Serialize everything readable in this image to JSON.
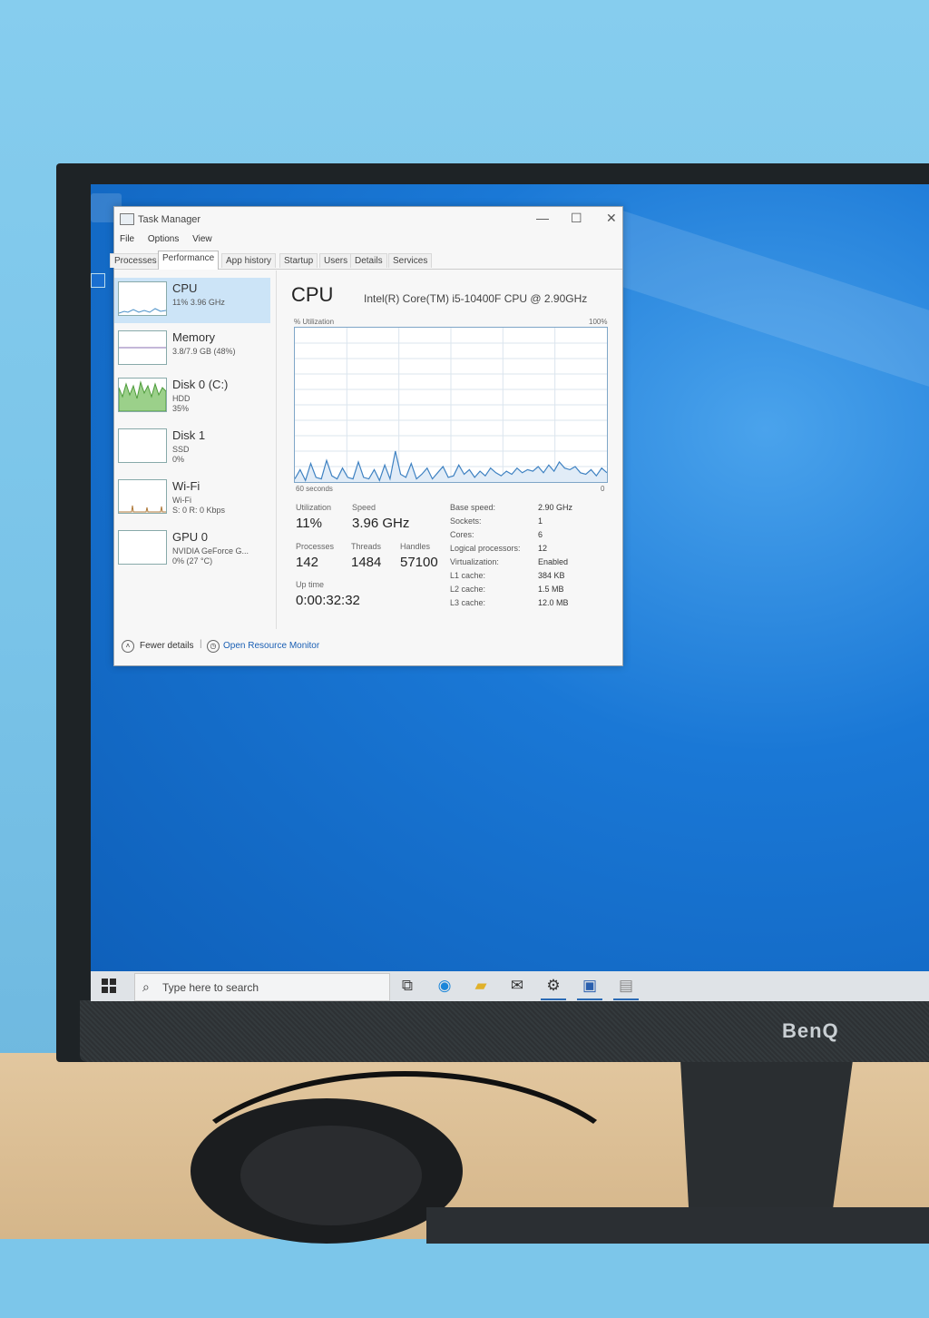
{
  "window": {
    "title": "Task Manager",
    "controls": {
      "minimize": "—",
      "maximize": "☐",
      "close": "✕"
    }
  },
  "menu": [
    "File",
    "Options",
    "View"
  ],
  "tabs": [
    "Processes",
    "Performance",
    "App history",
    "Startup",
    "Users",
    "Details",
    "Services"
  ],
  "active_tab": "Performance",
  "sidebar": {
    "items": [
      {
        "name": "CPU",
        "sub1": "11% 3.96 GHz",
        "sub2": "",
        "sub3": ""
      },
      {
        "name": "Memory",
        "sub1": "3.8/7.9 GB (48%)",
        "sub2": "",
        "sub3": ""
      },
      {
        "name": "Disk 0 (C:)",
        "sub1": "HDD",
        "sub2": "35%",
        "sub3": ""
      },
      {
        "name": "Disk 1",
        "sub1": "SSD",
        "sub2": "0%",
        "sub3": ""
      },
      {
        "name": "Wi-Fi",
        "sub1": "Wi-Fi",
        "sub2": "S: 0 R: 0 Kbps",
        "sub3": ""
      },
      {
        "name": "GPU 0",
        "sub1": "NVIDIA GeForce G...",
        "sub2": "0% (27 °C)",
        "sub3": ""
      }
    ]
  },
  "main": {
    "title": "CPU",
    "cpu_name": "Intel(R) Core(TM) i5-10400F CPU @ 2.90GHz",
    "graph_label_left": "% Utilization",
    "graph_label_right": "100%",
    "graph_bottom_left": "60 seconds",
    "graph_bottom_right": "0",
    "utilization_label": "Utilization",
    "utilization": "11%",
    "speed_label": "Speed",
    "speed": "3.96 GHz",
    "processes_label": "Processes",
    "processes": "142",
    "threads_label": "Threads",
    "threads": "1484",
    "handles_label": "Handles",
    "handles": "57100",
    "uptime_label": "Up time",
    "uptime": "0:00:32:32",
    "specs": [
      {
        "k": "Base speed:",
        "v": "2.90 GHz"
      },
      {
        "k": "Sockets:",
        "v": "1"
      },
      {
        "k": "Cores:",
        "v": "6"
      },
      {
        "k": "Logical processors:",
        "v": "12"
      },
      {
        "k": "Virtualization:",
        "v": "Enabled"
      },
      {
        "k": "L1 cache:",
        "v": "384 KB"
      },
      {
        "k": "L2 cache:",
        "v": "1.5 MB"
      },
      {
        "k": "L3 cache:",
        "v": "12.0 MB"
      }
    ]
  },
  "footer": {
    "fewer_details": "Fewer details",
    "resource_monitor": "Open Resource Monitor"
  },
  "taskbar": {
    "search_placeholder": "Type here to search"
  },
  "monitor_brand": "BenQ",
  "cpu_history": [
    2,
    8,
    1,
    12,
    3,
    2,
    14,
    4,
    2,
    9,
    3,
    2,
    13,
    3,
    2,
    8,
    1,
    11,
    2,
    20,
    5,
    3,
    12,
    2,
    5,
    9,
    2,
    6,
    10,
    3,
    4,
    11,
    5,
    8,
    3,
    7,
    4,
    9,
    6,
    4,
    7,
    5,
    9,
    6,
    8,
    7,
    10,
    6,
    11,
    7,
    13,
    9,
    8,
    10,
    6,
    5,
    8,
    4,
    9,
    6
  ]
}
